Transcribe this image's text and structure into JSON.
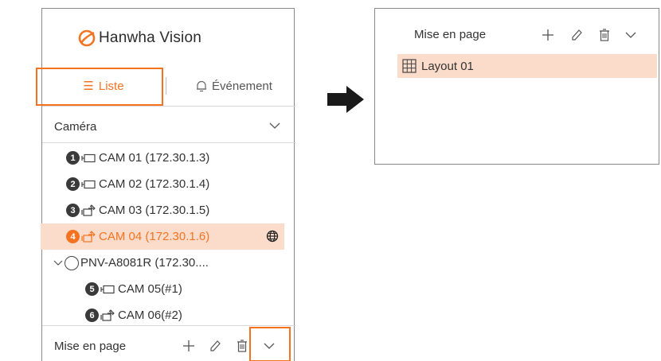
{
  "brand": {
    "name": "Hanwha Vision",
    "accent": "#f37321"
  },
  "tabs": {
    "list_label": "Liste",
    "event_label": "Événement"
  },
  "camera_section": {
    "label": "Caméra"
  },
  "cameras": [
    {
      "number": "1",
      "name": "CAM 01 (172.30.1.3)",
      "icon": "fixed-camera-icon"
    },
    {
      "number": "2",
      "name": "CAM 02 (172.30.1.4)",
      "icon": "fixed-camera-icon"
    },
    {
      "number": "3",
      "name": "CAM 03 (172.30.1.5)",
      "icon": "ptz-camera-icon"
    },
    {
      "number": "4",
      "name": "CAM 04 (172.30.1.6)",
      "icon": "ptz-camera-icon",
      "selected": true,
      "badge_icon": "globe-icon"
    }
  ],
  "group": {
    "name": "PNV-A8081R (172.30....",
    "children": [
      {
        "number": "5",
        "name": "CAM 05(#1)",
        "icon": "fixed-camera-icon"
      },
      {
        "number": "6",
        "name": "CAM 06(#2)",
        "icon": "ptz-camera-icon"
      }
    ]
  },
  "layout_bar": {
    "label": "Mise en page"
  },
  "layout_panel": {
    "label": "Mise en page",
    "layouts": [
      {
        "name": "Layout 01"
      }
    ]
  }
}
